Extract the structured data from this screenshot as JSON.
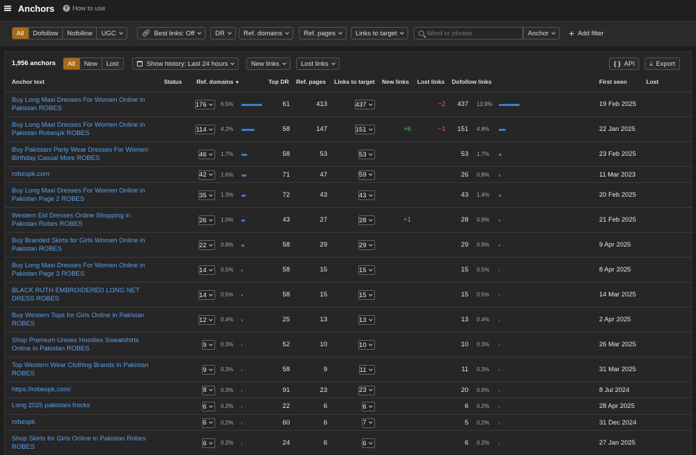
{
  "header": {
    "title": "Anchors",
    "howto": "How to use"
  },
  "filters": {
    "types": [
      "All",
      "Dofollow",
      "Nofollow",
      "UGC"
    ],
    "best_links": "Best links: Off",
    "dr": "DR",
    "ref_domains": "Ref. domains",
    "ref_pages": "Ref. pages",
    "links_to_target": "Links to target",
    "search_placeholder": "Word or phrase",
    "anchor_mode": "Anchor",
    "add_filter": "Add filter"
  },
  "panel": {
    "count": "1,956 anchors",
    "tabs": [
      "All",
      "New",
      "Lost"
    ],
    "history": "Show history: Last 24 hours",
    "new_links": "New links",
    "lost_links": "Lost links",
    "api": "API",
    "export": "Export"
  },
  "columns": {
    "anchor": "Anchor text",
    "status": "Status",
    "ref_domains": "Ref. domains",
    "top_dr": "Top DR",
    "ref_pages": "Ref. pages",
    "links_to_target": "Links to target",
    "new_links": "New links",
    "lost_links": "Lost links",
    "dofollow": "Dofollow links",
    "first_seen": "First seen",
    "lost": "Lost"
  },
  "rows": [
    {
      "anchor": "Buy Long Maxi Dresses For Women Online in Pakistan ROBES",
      "ref_domains": "176",
      "rd_pct": "6.5%",
      "rd_frac": 0.065,
      "top_dr": "61",
      "ref_pages": "413",
      "links": "437",
      "new": "",
      "lost": "−2",
      "dofollow": "437",
      "df_pct": "13.9%",
      "df_frac": 0.139,
      "first_seen": "19 Feb 2025"
    },
    {
      "anchor": "Buy Long Maxi Dresses For Women Online in Pakistan Robespk ROBES",
      "ref_domains": "114",
      "rd_pct": "4.2%",
      "rd_frac": 0.042,
      "top_dr": "58",
      "ref_pages": "147",
      "links": "151",
      "new": "+6",
      "lost": "−1",
      "dofollow": "151",
      "df_pct": "4.8%",
      "df_frac": 0.048,
      "first_seen": "22 Jan 2025"
    },
    {
      "anchor": "Buy Pakistani Party Wear Dresses For Women Birthday Casual More ROBES",
      "ref_domains": "46",
      "rd_pct": "1.7%",
      "rd_frac": 0.017,
      "top_dr": "58",
      "ref_pages": "53",
      "links": "53",
      "new": "",
      "lost": "",
      "dofollow": "53",
      "df_pct": "1.7%",
      "df_frac": 0.017,
      "first_seen": "23 Feb 2025"
    },
    {
      "anchor": "robespk.com",
      "ref_domains": "42",
      "rd_pct": "1.6%",
      "rd_frac": 0.016,
      "top_dr": "71",
      "ref_pages": "47",
      "links": "59",
      "new": "",
      "lost": "",
      "dofollow": "26",
      "df_pct": "0.8%",
      "df_frac": 0.008,
      "first_seen": "11 Mar 2023"
    },
    {
      "anchor": "Buy Long Maxi Dresses For Women Online in Pakistan Page 2 ROBES",
      "ref_domains": "35",
      "rd_pct": "1.3%",
      "rd_frac": 0.013,
      "top_dr": "72",
      "ref_pages": "43",
      "links": "43",
      "new": "",
      "lost": "",
      "dofollow": "43",
      "df_pct": "1.4%",
      "df_frac": 0.014,
      "first_seen": "20 Feb 2025"
    },
    {
      "anchor": "Western Eid Dresses Online Shopping in Pakistan Robes ROBES",
      "ref_domains": "26",
      "rd_pct": "1.0%",
      "rd_frac": 0.01,
      "top_dr": "43",
      "ref_pages": "27",
      "links": "28",
      "new": "+1",
      "lost": "",
      "dofollow": "28",
      "df_pct": "0.9%",
      "df_frac": 0.009,
      "first_seen": "21 Feb 2025"
    },
    {
      "anchor": "Buy Branded Skirts for Girls Women Online in Pakistan ROBES",
      "ref_domains": "22",
      "rd_pct": "0.8%",
      "rd_frac": 0.008,
      "top_dr": "58",
      "ref_pages": "29",
      "links": "29",
      "new": "",
      "lost": "",
      "dofollow": "29",
      "df_pct": "0.9%",
      "df_frac": 0.009,
      "first_seen": "9 Apr 2025"
    },
    {
      "anchor": "Buy Long Maxi Dresses For Women Online in Pakistan Page 3 ROBES",
      "ref_domains": "14",
      "rd_pct": "0.5%",
      "rd_frac": 0.005,
      "top_dr": "58",
      "ref_pages": "15",
      "links": "15",
      "new": "",
      "lost": "",
      "dofollow": "15",
      "df_pct": "0.5%",
      "df_frac": 0.005,
      "first_seen": "8 Apr 2025"
    },
    {
      "anchor": "BLACK RUTH EMBROIDERED LONG NET DRESS ROBES",
      "ref_domains": "14",
      "rd_pct": "0.5%",
      "rd_frac": 0.005,
      "top_dr": "58",
      "ref_pages": "15",
      "links": "15",
      "new": "",
      "lost": "",
      "dofollow": "15",
      "df_pct": "0.5%",
      "df_frac": 0.005,
      "first_seen": "14 Mar 2025"
    },
    {
      "anchor": "Buy Western Tops for Girls Online in Pakistan ROBES",
      "ref_domains": "12",
      "rd_pct": "0.4%",
      "rd_frac": 0.004,
      "top_dr": "25",
      "ref_pages": "13",
      "links": "13",
      "new": "",
      "lost": "",
      "dofollow": "13",
      "df_pct": "0.4%",
      "df_frac": 0.004,
      "first_seen": "2 Apr 2025"
    },
    {
      "anchor": "Shop Premium Unisex Hoodies Sweatshirts Online in Pakistan ROBES",
      "ref_domains": "9",
      "rd_pct": "0.3%",
      "rd_frac": 0.003,
      "top_dr": "52",
      "ref_pages": "10",
      "links": "10",
      "new": "",
      "lost": "",
      "dofollow": "10",
      "df_pct": "0.3%",
      "df_frac": 0.003,
      "first_seen": "26 Mar 2025"
    },
    {
      "anchor": "Top Western Wear Clothing Brands in Pakistan ROBES",
      "ref_domains": "9",
      "rd_pct": "0.3%",
      "rd_frac": 0.003,
      "top_dr": "58",
      "ref_pages": "9",
      "links": "11",
      "new": "",
      "lost": "",
      "dofollow": "11",
      "df_pct": "0.3%",
      "df_frac": 0.003,
      "first_seen": "31 Mar 2025"
    },
    {
      "anchor": "https://robespk.com/",
      "ref_domains": "8",
      "rd_pct": "0.3%",
      "rd_frac": 0.003,
      "top_dr": "91",
      "ref_pages": "23",
      "links": "23",
      "new": "",
      "lost": "",
      "dofollow": "20",
      "df_pct": "0.6%",
      "df_frac": 0.006,
      "first_seen": "8 Jul 2024"
    },
    {
      "anchor": "Long 2025 pakistani frocks",
      "ref_domains": "6",
      "rd_pct": "0.2%",
      "rd_frac": 0.002,
      "top_dr": "22",
      "ref_pages": "6",
      "links": "6",
      "new": "",
      "lost": "",
      "dofollow": "6",
      "df_pct": "0.2%",
      "df_frac": 0.002,
      "first_seen": "28 Apr 2025"
    },
    {
      "anchor": "robespk",
      "ref_domains": "6",
      "rd_pct": "0.2%",
      "rd_frac": 0.002,
      "top_dr": "60",
      "ref_pages": "6",
      "links": "7",
      "new": "",
      "lost": "",
      "dofollow": "5",
      "df_pct": "0.2%",
      "df_frac": 0.002,
      "first_seen": "31 Dec 2024"
    },
    {
      "anchor": "Shop Skirts for Girls Online in Pakistan Robes ROBES",
      "ref_domains": "6",
      "rd_pct": "0.2%",
      "rd_frac": 0.002,
      "top_dr": "24",
      "ref_pages": "6",
      "links": "6",
      "new": "",
      "lost": "",
      "dofollow": "6",
      "df_pct": "0.2%",
      "df_frac": 0.002,
      "first_seen": "27 Jan 2025"
    }
  ]
}
